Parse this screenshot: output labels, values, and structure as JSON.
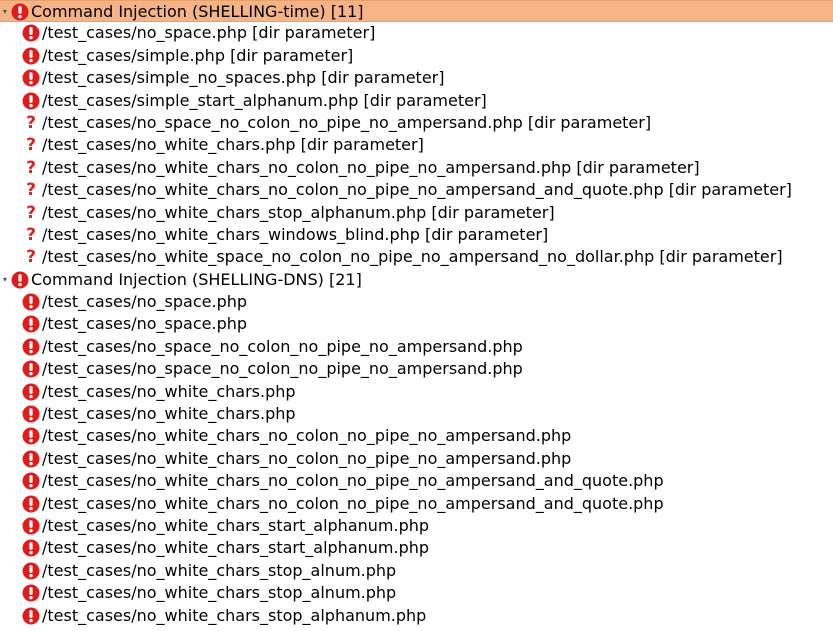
{
  "colors": {
    "alert_red": "#e01b1b",
    "selected_bg": "#f6b486",
    "question_red": "#e02020"
  },
  "icons": {
    "alert": "exclamation-circle-icon",
    "unknown": "question-mark-icon",
    "expanded": "expanded-triangle-icon"
  },
  "groups": [
    {
      "title": "Command Injection (SHELLING-time) [11]",
      "selected": true,
      "items": [
        {
          "path": "/test_cases/no_space.php [dir parameter]",
          "icon": "alert"
        },
        {
          "path": "/test_cases/simple.php [dir parameter]",
          "icon": "alert"
        },
        {
          "path": "/test_cases/simple_no_spaces.php [dir parameter]",
          "icon": "alert"
        },
        {
          "path": "/test_cases/simple_start_alphanum.php [dir parameter]",
          "icon": "alert"
        },
        {
          "path": "/test_cases/no_space_no_colon_no_pipe_no_ampersand.php [dir parameter]",
          "icon": "unknown"
        },
        {
          "path": "/test_cases/no_white_chars.php [dir parameter]",
          "icon": "unknown"
        },
        {
          "path": "/test_cases/no_white_chars_no_colon_no_pipe_no_ampersand.php [dir parameter]",
          "icon": "unknown"
        },
        {
          "path": "/test_cases/no_white_chars_no_colon_no_pipe_no_ampersand_and_quote.php [dir parameter]",
          "icon": "unknown"
        },
        {
          "path": "/test_cases/no_white_chars_stop_alphanum.php [dir parameter]",
          "icon": "unknown"
        },
        {
          "path": "/test_cases/no_white_chars_windows_blind.php [dir parameter]",
          "icon": "unknown"
        },
        {
          "path": "/test_cases/no_white_space_no_colon_no_pipe_no_ampersand_no_dollar.php [dir parameter]",
          "icon": "unknown"
        }
      ]
    },
    {
      "title": "Command Injection (SHELLING-DNS) [21]",
      "selected": false,
      "items": [
        {
          "path": "/test_cases/no_space.php",
          "icon": "alert"
        },
        {
          "path": "/test_cases/no_space.php",
          "icon": "alert"
        },
        {
          "path": "/test_cases/no_space_no_colon_no_pipe_no_ampersand.php",
          "icon": "alert"
        },
        {
          "path": "/test_cases/no_space_no_colon_no_pipe_no_ampersand.php",
          "icon": "alert"
        },
        {
          "path": "/test_cases/no_white_chars.php",
          "icon": "alert"
        },
        {
          "path": "/test_cases/no_white_chars.php",
          "icon": "alert"
        },
        {
          "path": "/test_cases/no_white_chars_no_colon_no_pipe_no_ampersand.php",
          "icon": "alert"
        },
        {
          "path": "/test_cases/no_white_chars_no_colon_no_pipe_no_ampersand.php",
          "icon": "alert"
        },
        {
          "path": "/test_cases/no_white_chars_no_colon_no_pipe_no_ampersand_and_quote.php",
          "icon": "alert"
        },
        {
          "path": "/test_cases/no_white_chars_no_colon_no_pipe_no_ampersand_and_quote.php",
          "icon": "alert"
        },
        {
          "path": "/test_cases/no_white_chars_start_alphanum.php",
          "icon": "alert"
        },
        {
          "path": "/test_cases/no_white_chars_start_alphanum.php",
          "icon": "alert"
        },
        {
          "path": "/test_cases/no_white_chars_stop_alnum.php",
          "icon": "alert"
        },
        {
          "path": "/test_cases/no_white_chars_stop_alnum.php",
          "icon": "alert"
        },
        {
          "path": "/test_cases/no_white_chars_stop_alphanum.php",
          "icon": "alert"
        }
      ]
    }
  ]
}
